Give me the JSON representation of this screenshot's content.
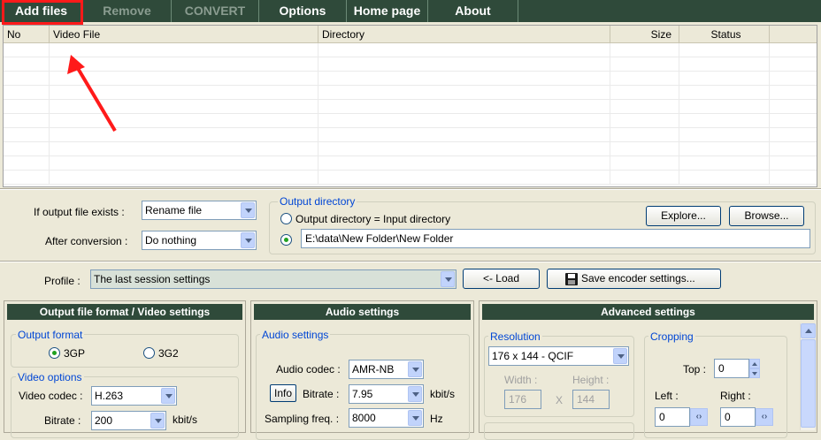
{
  "menu": {
    "add_files": "Add files",
    "remove": "Remove",
    "convert": "CONVERT",
    "options": "Options",
    "home_page": "Home page",
    "about": "About"
  },
  "table": {
    "headers": [
      "No",
      "Video File",
      "Directory",
      "Size",
      "Status"
    ]
  },
  "output": {
    "if_exists_label": "If output file exists :",
    "if_exists_value": "Rename file",
    "after_conversion_label": "After conversion :",
    "after_conversion_value": "Do nothing",
    "dir_group_title": "Output directory",
    "radio_same_label": "Output directory = Input directory",
    "dir_path": "E:\\data\\New Folder\\New Folder",
    "explore_label": "Explore...",
    "browse_label": "Browse..."
  },
  "profile": {
    "label": "Profile :",
    "value": "The last session settings",
    "load_label": "<- Load",
    "save_label": "Save encoder settings..."
  },
  "video_panel": {
    "title": "Output file format / Video settings",
    "format_group": "Output format",
    "opt_3gp": "3GP",
    "opt_3g2": "3G2",
    "video_options_group": "Video options",
    "codec_label": "Video codec :",
    "codec_value": "H.263",
    "bitrate_label": "Bitrate :",
    "bitrate_value": "200",
    "bitrate_unit": "kbit/s"
  },
  "audio_panel": {
    "title": "Audio settings",
    "group": "Audio settings",
    "codec_label": "Audio codec :",
    "codec_value": "AMR-NB",
    "info_label": "Info",
    "bitrate_label": "Bitrate :",
    "bitrate_value": "7.95",
    "bitrate_unit": "kbit/s",
    "sampling_label": "Sampling freq. :",
    "sampling_value": "8000",
    "sampling_unit": "Hz"
  },
  "advanced_panel": {
    "title": "Advanced settings",
    "resolution_group": "Resolution",
    "resolution_value": "176 x 144 - QCIF",
    "width_label": "Width :",
    "width_value": "176",
    "x_label": "X",
    "height_label": "Height :",
    "height_value": "144",
    "cropping_group": "Cropping",
    "top_label": "Top :",
    "top_value": "0",
    "left_label": "Left :",
    "left_value": "0",
    "right_label": "Right :",
    "right_value": "0",
    "arrows_glyph": "‹›"
  }
}
